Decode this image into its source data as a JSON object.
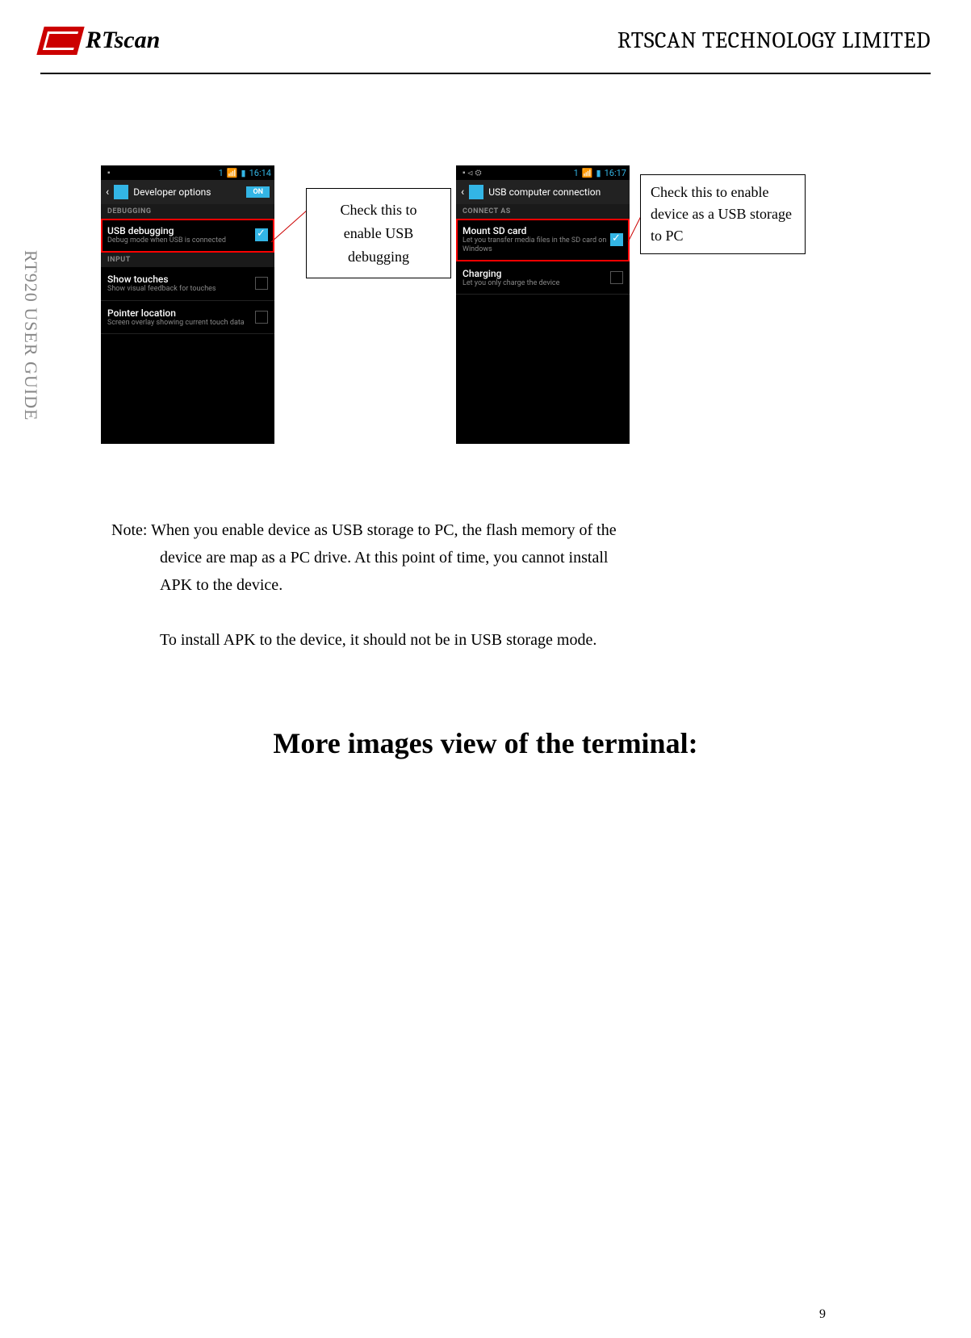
{
  "header": {
    "logo_text": "RTscan",
    "company": "RTSCAN TECHNOLOGY LIMITED"
  },
  "sidebar": "RT920 USER GUIDE",
  "phone1": {
    "status": {
      "signal_num": "1",
      "time": "16:14"
    },
    "nav_title": "Developer options",
    "toggle": "ON",
    "section1": "DEBUGGING",
    "row1_title": "USB debugging",
    "row1_sub": "Debug mode when USB is connected",
    "section2": "INPUT",
    "row2_title": "Show touches",
    "row2_sub": "Show visual feedback for touches",
    "row3_title": "Pointer location",
    "row3_sub": "Screen overlay showing current touch data"
  },
  "phone2": {
    "status": {
      "signal_num": "1",
      "time": "16:17"
    },
    "nav_title": "USB computer connection",
    "section1": "CONNECT AS",
    "row1_title": "Mount SD card",
    "row1_sub": "Let you transfer media files in the SD card on Windows",
    "row2_title": "Charging",
    "row2_sub": "Let you only charge the device"
  },
  "callout1": "Check this to enable USB debugging",
  "callout2": "Check this to enable device as a USB storage to PC",
  "note": {
    "line1": "Note: When you enable device as USB storage to PC, the flash memory of the",
    "line2": "device are map as a PC drive.    At this point of time, you cannot install",
    "line3": "APK to the device.",
    "line4": "To install APK to the device, it should not be in USB storage mode."
  },
  "section_title": "More images view of the terminal:",
  "page_number": "9"
}
